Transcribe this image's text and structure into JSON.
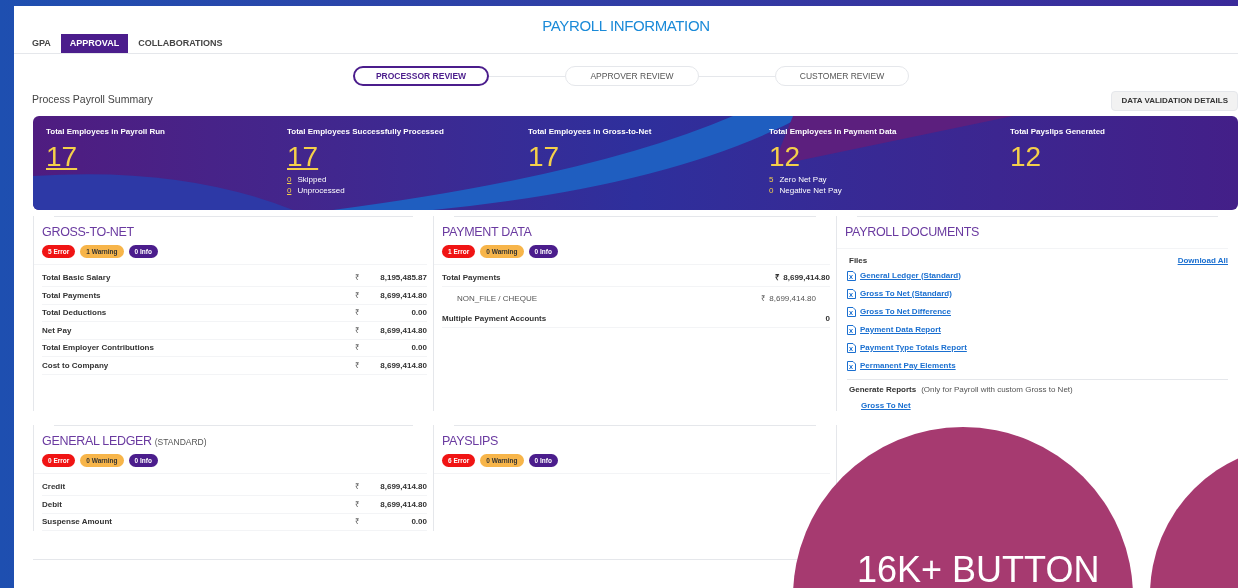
{
  "title": "PAYROLL INFORMATION",
  "tabs": [
    {
      "label": "GPA",
      "selected": false
    },
    {
      "label": "APPROVAL",
      "selected": true
    },
    {
      "label": "COLLABORATIONS",
      "selected": false
    }
  ],
  "steps": [
    {
      "label": "PROCESSOR REVIEW",
      "selected": true
    },
    {
      "label": "APPROVER REVIEW",
      "selected": false
    },
    {
      "label": "CUSTOMER REVIEW",
      "selected": false
    }
  ],
  "summary_title": "Process Payroll Summary",
  "validation_button": "DATA VALIDATION DETAILS",
  "stats": [
    {
      "label": "Total Employees in Payroll Run",
      "value": "17",
      "linked": true
    },
    {
      "label": "Total Employees Successfully Processed",
      "value": "17",
      "linked": true,
      "details": [
        {
          "count": "0",
          "label": "Skipped",
          "linked": true
        },
        {
          "count": "0",
          "label": "Unprocessed",
          "linked": true
        }
      ]
    },
    {
      "label": "Total Employees in Gross-to-Net",
      "value": "17",
      "linked": false
    },
    {
      "label": "Total Employees in Payment Data",
      "value": "12",
      "linked": false,
      "details": [
        {
          "count": "5",
          "label": "Zero Net Pay",
          "linked": false
        },
        {
          "count": "0",
          "label": "Negative Net Pay",
          "linked": false
        }
      ]
    },
    {
      "label": "Total Payslips Generated",
      "value": "12",
      "linked": false
    }
  ],
  "gross_to_net": {
    "title": "GROSS-TO-NET",
    "badges": [
      {
        "kind": "error",
        "label": "5 Error"
      },
      {
        "kind": "warning",
        "label": "1 Warning"
      },
      {
        "kind": "info",
        "label": "0 Info"
      }
    ],
    "rows": [
      {
        "label": "Total Basic Salary",
        "currency": "₹",
        "amount": "8,195,485.87"
      },
      {
        "label": "Total Payments",
        "currency": "₹",
        "amount": "8,699,414.80"
      },
      {
        "label": "Total Deductions",
        "currency": "₹",
        "amount": "0.00"
      },
      {
        "label": "Net Pay",
        "currency": "₹",
        "amount": "8,699,414.80"
      },
      {
        "label": "Total Employer Contributions",
        "currency": "₹",
        "amount": "0.00"
      },
      {
        "label": "Cost to Company",
        "currency": "₹",
        "amount": "8,699,414.80"
      }
    ]
  },
  "payment_data": {
    "title": "PAYMENT DATA",
    "badges": [
      {
        "kind": "error",
        "label": "1 Error"
      },
      {
        "kind": "warning",
        "label": "0 Warning"
      },
      {
        "kind": "info",
        "label": "0 Info"
      }
    ],
    "rows": [
      {
        "kind": "total",
        "label": "Total Payments",
        "currency": "₹",
        "amount": "8,699,414.80"
      },
      {
        "kind": "sub",
        "label": "NON_FILE / CHEQUE",
        "currency": "₹",
        "amount": "8,699,414.80"
      },
      {
        "kind": "count",
        "label": "Multiple Payment Accounts",
        "amount": "0"
      }
    ]
  },
  "payroll_documents": {
    "title": "PAYROLL DOCUMENTS",
    "files_label": "Files",
    "download_all": "Download All",
    "files": [
      "General Ledger (Standard)",
      "Gross To Net (Standard)",
      "Gross To Net Difference",
      "Payment Data Report",
      "Payment Type Totals Report",
      "Permanent Pay Elements"
    ],
    "generate_label": "Generate Reports",
    "generate_note": "(Only for Payroll with custom Gross to Net)",
    "reports": [
      "Gross To Net"
    ]
  },
  "general_ledger": {
    "title": "GENERAL LEDGER",
    "subtitle": "(STANDARD)",
    "badges": [
      {
        "kind": "error",
        "label": "0 Error"
      },
      {
        "kind": "warning",
        "label": "0 Warning"
      },
      {
        "kind": "info",
        "label": "0 Info"
      }
    ],
    "rows": [
      {
        "label": "Credit",
        "currency": "₹",
        "amount": "8,699,414.80"
      },
      {
        "label": "Debit",
        "currency": "₹",
        "amount": "8,699,414.80"
      },
      {
        "label": "Suspense Amount",
        "currency": "₹",
        "amount": "0.00"
      }
    ]
  },
  "payslips": {
    "title": "PAYSLIPS",
    "badges": [
      {
        "kind": "error",
        "label": "6 Error"
      },
      {
        "kind": "warning",
        "label": "0 Warning"
      },
      {
        "kind": "info",
        "label": "0 Info"
      }
    ]
  },
  "promo": {
    "text": "16K+ BUTTON"
  }
}
